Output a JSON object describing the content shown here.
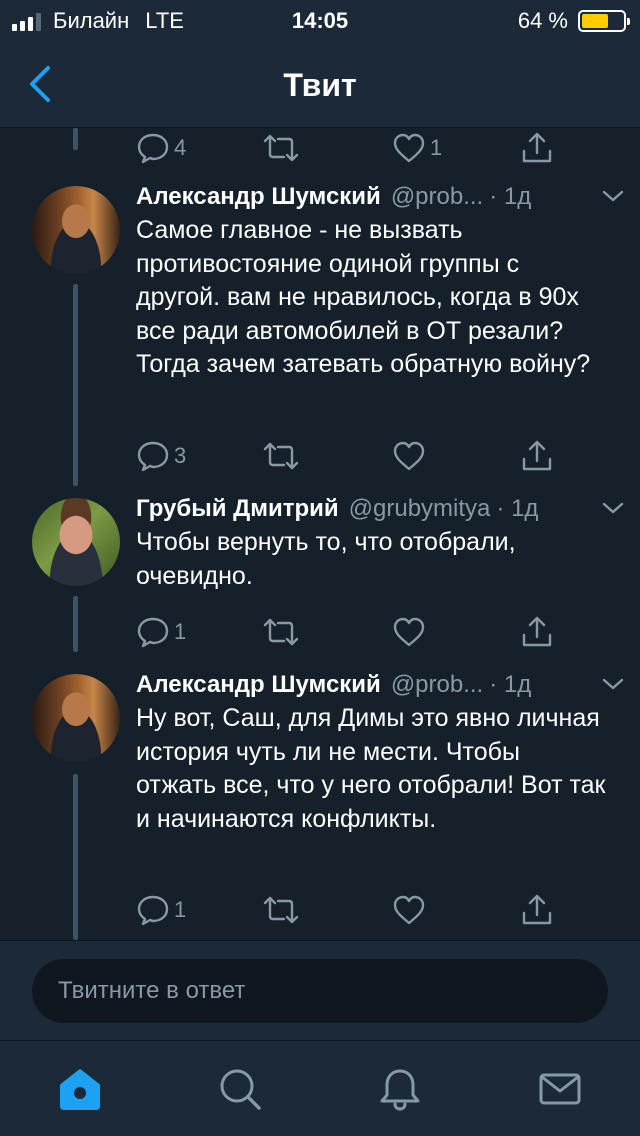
{
  "status_bar": {
    "carrier": "Билайн",
    "network": "LTE",
    "time": "14:05",
    "battery_percent": "64 %",
    "battery_level": 0.64
  },
  "header": {
    "title": "Твит"
  },
  "top_actions": {
    "reply_count": "4",
    "retweet_count": "",
    "like_count": "1"
  },
  "tweets": [
    {
      "name": "Александр Шумский",
      "handle": "@prob...",
      "time": "· 1д",
      "text": "Самое главное - не вызвать противостояние одиной группы с другой. вам не нравилось, когда в 90х все ради автомобилей в ОТ резали? Тогда зачем затевать обратную войну?",
      "reply_count": "3",
      "retweet_count": "",
      "like_count": ""
    },
    {
      "name": "Грубый Дмитрий",
      "handle": "@grubymitya",
      "time": "· 1д",
      "text": "Чтобы вернуть то, что отобрали, очевидно.",
      "reply_count": "1",
      "retweet_count": "",
      "like_count": ""
    },
    {
      "name": "Александр Шумский",
      "handle": "@prob...",
      "time": "· 1д",
      "text": "Ну вот, Саш, для Димы это явно личная история чуть ли не мести. Чтобы отжать все, что у него отобрали! Вот так и начинаются конфликты.",
      "reply_count": "1",
      "retweet_count": "",
      "like_count": ""
    }
  ],
  "reply": {
    "placeholder": "Твитните в ответ"
  },
  "colors": {
    "background": "#15202b",
    "bar": "#1c2938",
    "accent": "#1da1f2",
    "muted": "#8899a6"
  },
  "tab_bar": {
    "active": "home",
    "tabs": [
      "home-icon",
      "search-icon",
      "notifications-icon",
      "messages-icon"
    ]
  }
}
